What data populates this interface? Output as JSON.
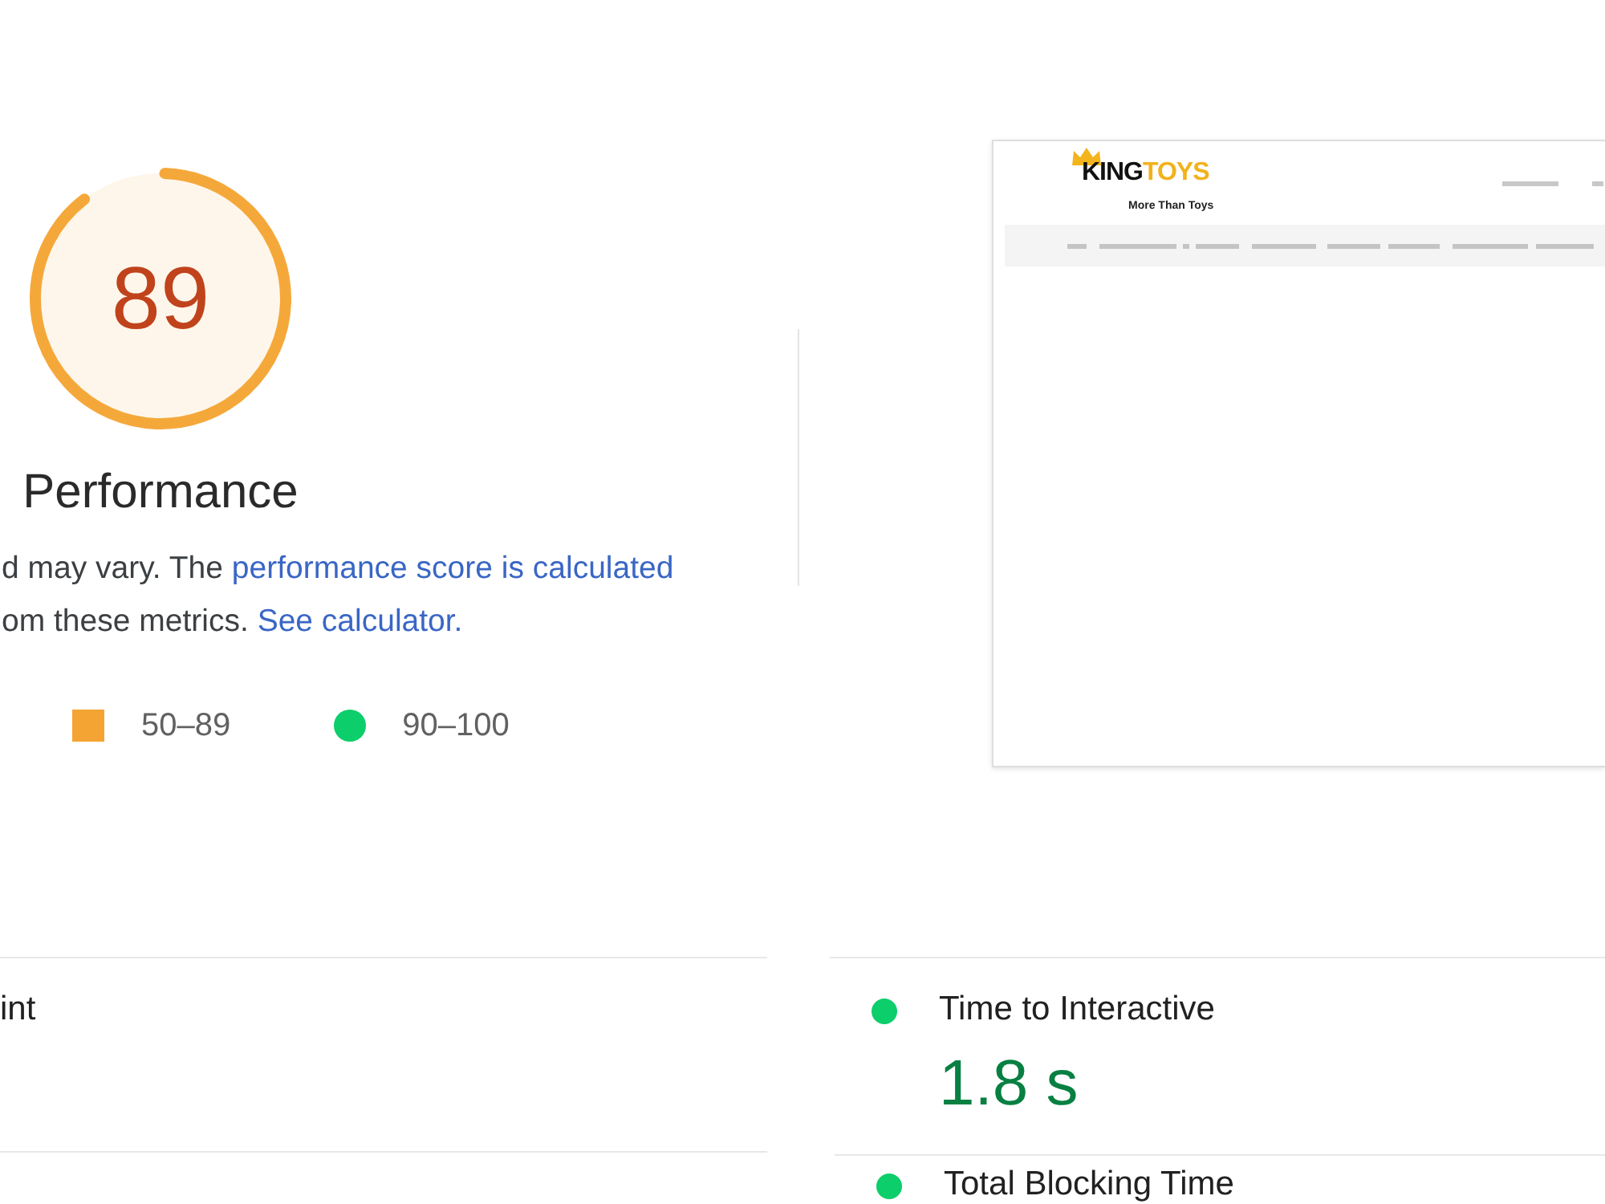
{
  "score_gauge": {
    "score": "89",
    "title": "Performance"
  },
  "description": [
    {
      "kind": "text",
      "text": "d may vary. The"
    },
    {
      "kind": "link",
      "text": "performance score is calculated"
    },
    {
      "kind": "text",
      "text": "om these metrics."
    },
    {
      "kind": "link",
      "text": "See calculator."
    }
  ],
  "legend": [
    {
      "kind": "square",
      "color": "#f4a433",
      "range": "50–89"
    },
    {
      "kind": "circle",
      "color": "#0cce6b",
      "range": "90–100"
    }
  ],
  "screenshot_preview": {
    "logo": {
      "word_1": "KING",
      "word_2": "TOYS",
      "tagline": "More Than Toys"
    }
  },
  "metrics": {
    "left": [
      {
        "title": "int"
      }
    ],
    "right": [
      {
        "title": "Time to Interactive",
        "value": "1.8 s",
        "color": "#0cce6b"
      },
      {
        "title": "Total Blocking Time",
        "color": "#0cce6b"
      }
    ]
  }
}
